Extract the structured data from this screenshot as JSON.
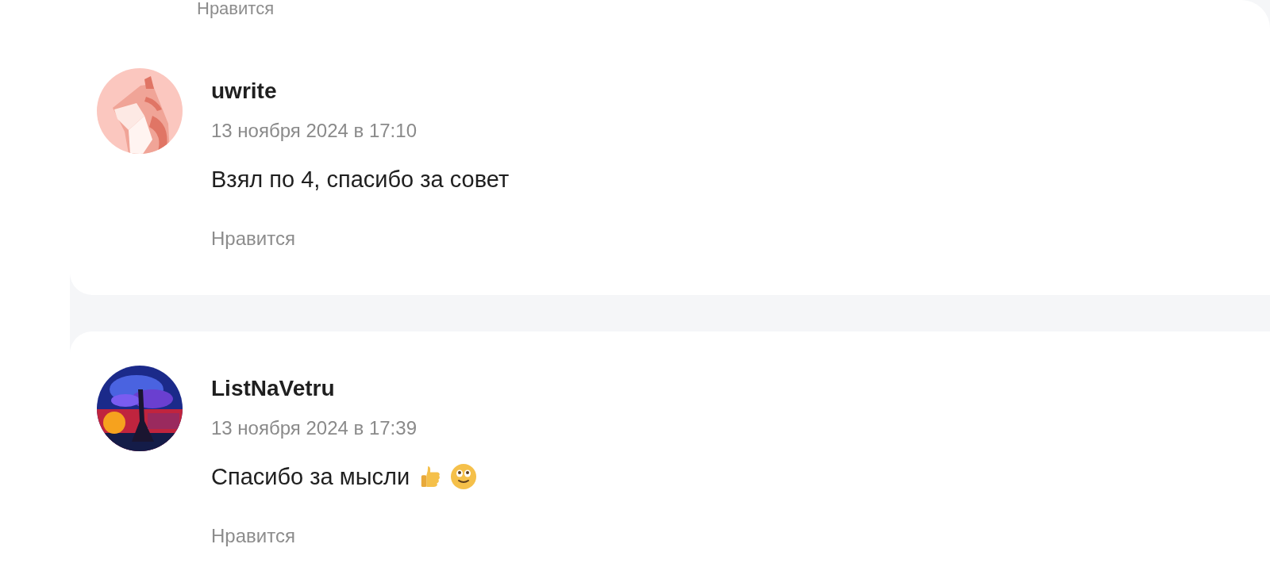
{
  "previous_comment": {
    "like_label": "Нравится"
  },
  "comments": [
    {
      "author": "uwrite",
      "date": "13 ноября 2024 в 17:10",
      "text": "Взял по 4, спасибо за совет",
      "like_label": "Нравится"
    },
    {
      "author": "ListNaVetru",
      "date": "13 ноября 2024 в 17:39",
      "text": "Спасибо за мысли",
      "emoji": [
        {
          "kind": "thumbs_up"
        },
        {
          "kind": "smiling_face"
        }
      ],
      "like_label": "Нравится"
    }
  ]
}
